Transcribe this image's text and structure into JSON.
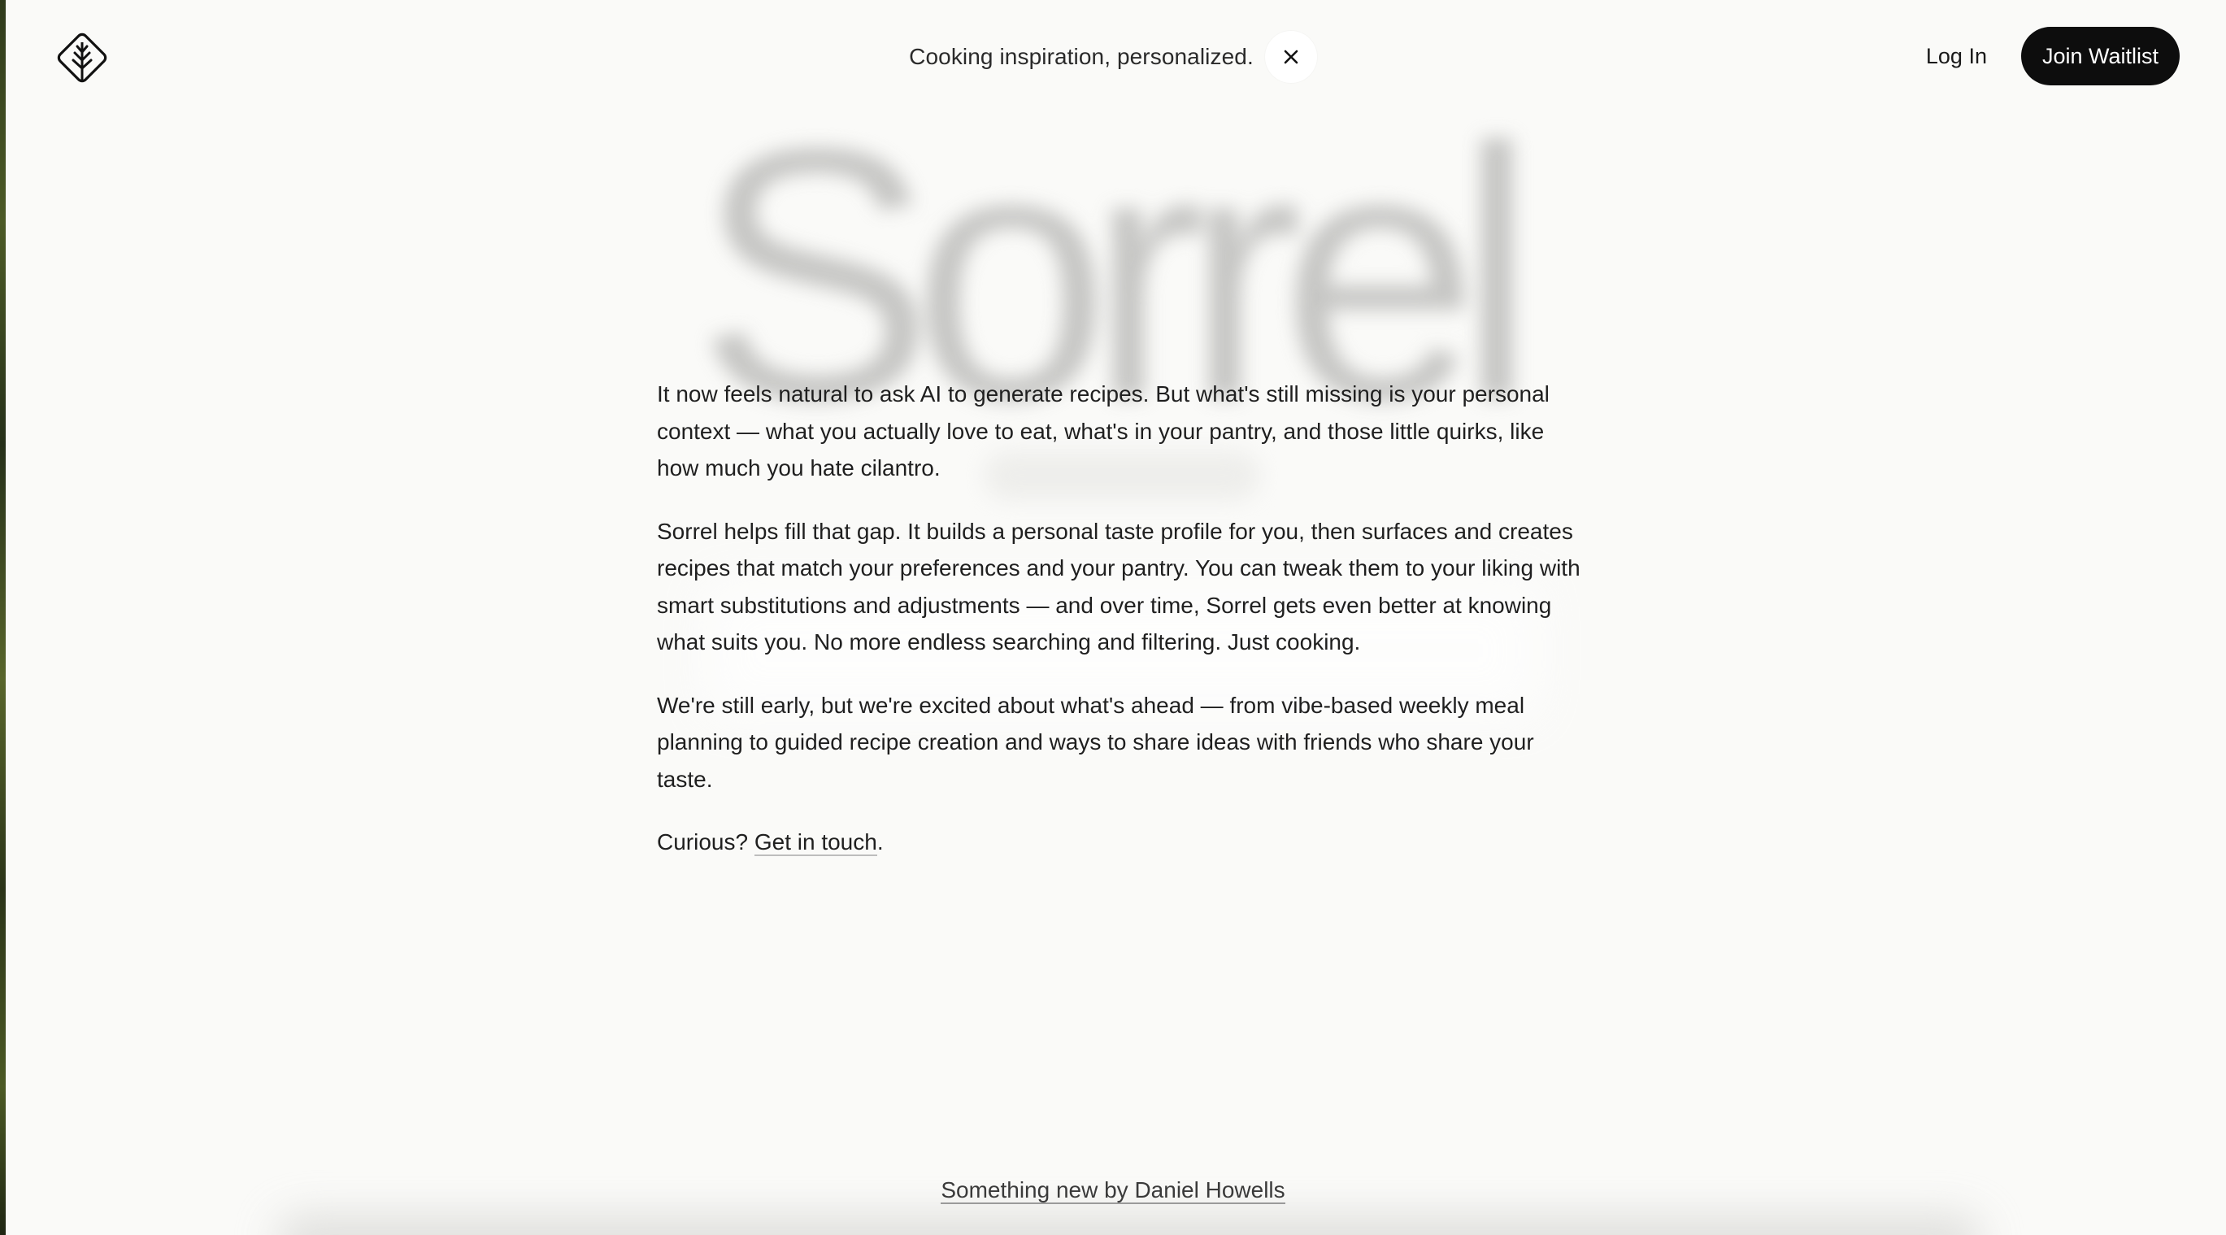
{
  "header": {
    "logo_icon": "sorrel-leaf-diamond-icon",
    "tagline": "Cooking inspiration, personalized.",
    "close_icon": "close-icon",
    "login_label": "Log In",
    "join_label": "Join Waitlist"
  },
  "hero": {
    "wordmark": "Sorrel"
  },
  "main": {
    "paragraphs": [
      "It now feels natural to ask AI to generate recipes. But what's still missing is your personal context — what you actually love to eat, what's in your pantry, and those little quirks, like how much you hate cilantro.",
      "Sorrel helps fill that gap. It builds a personal taste profile for you, then surfaces and creates recipes that match your preferences and your pantry. You can tweak them to your liking with smart substitutions and adjustments — and over time, Sorrel gets even better at knowing what suits you. No more endless searching and filtering. Just cooking.",
      "We're still early, but we're excited about what's ahead — from vibe-based weekly meal planning to guided recipe creation and ways to share ideas with friends who share your taste."
    ],
    "cta_prefix": "Curious? ",
    "cta_link": "Get in touch",
    "cta_suffix": "."
  },
  "footer": {
    "credit_link": "Something new by Daniel Howells"
  },
  "colors": {
    "background": "#fafaf8",
    "text": "#1f1f1f",
    "button": "#0d0d0d",
    "button_text": "#ffffff",
    "wordmark": "#bdbdbb"
  }
}
